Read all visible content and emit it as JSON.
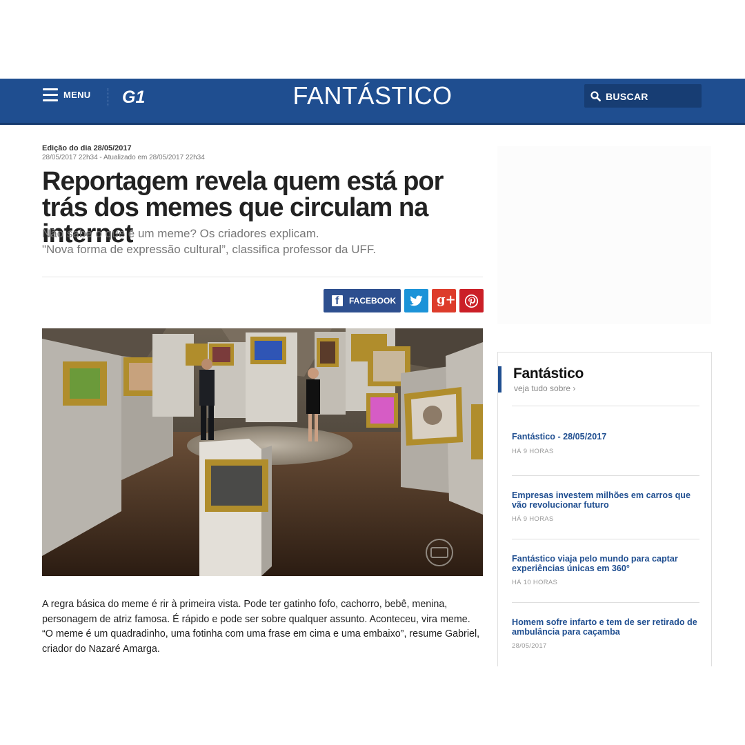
{
  "header": {
    "menu_label": "MENU",
    "logo_text": "G1",
    "show_title": "FANTÁSTICO",
    "search_label": "BUSCAR"
  },
  "article": {
    "edition": "Edição do dia 28/05/2017",
    "dates": "28/05/2017 22h34 - Atualizado em 28/05/2017 22h34",
    "headline": "Reportagem revela quem está por trás dos memes que circulam na internet",
    "subtitle_line1": "Não sabe o que é um meme? Os criadores explicam.",
    "subtitle_line2": "\"Nova forma de expressão cultural”, classifica professor da UFF.",
    "body": "A regra básica do meme é rir à primeira vista. Pode ter gatinho fofo, cachorro, bebê, menina, personagem de atriz famosa. É rápido e pode ser sobre qualquer assunto. Aconteceu, vira meme. “O meme é um quadradinho, uma fotinha com uma frase em cima e uma embaixo”, resume Gabriel, criador do Nazaré Amarga."
  },
  "share": {
    "facebook_label": "FACEBOOK",
    "facebook_icon": "facebook-icon",
    "twitter_icon": "twitter-bird-icon",
    "googleplus_label": "g+",
    "pinterest_icon": "pinterest-icon"
  },
  "sidebar": {
    "title": "Fantástico",
    "more_link": "veja tudo sobre ›",
    "items": [
      {
        "title": "Fantástico - 28/05/2017",
        "time": "HÁ 9 HORAS"
      },
      {
        "title": "Empresas investem milhões em carros que vão revolucionar futuro",
        "time": "HÁ 9 HORAS"
      },
      {
        "title": "Fantástico viaja pelo mundo para captar experiências únicas em 360°",
        "time": "HÁ 10 HORAS"
      },
      {
        "title": "Homem sofre infarto e tem de ser retirado de ambulância para caçamba",
        "time": "28/05/2017"
      }
    ]
  },
  "colors": {
    "header_bg": "#1f4e90",
    "link_blue": "#1f4e90",
    "facebook": "#2d4f8f",
    "twitter": "#1c93d8",
    "googleplus": "#dd3c2b",
    "pinterest": "#cb1f27"
  }
}
